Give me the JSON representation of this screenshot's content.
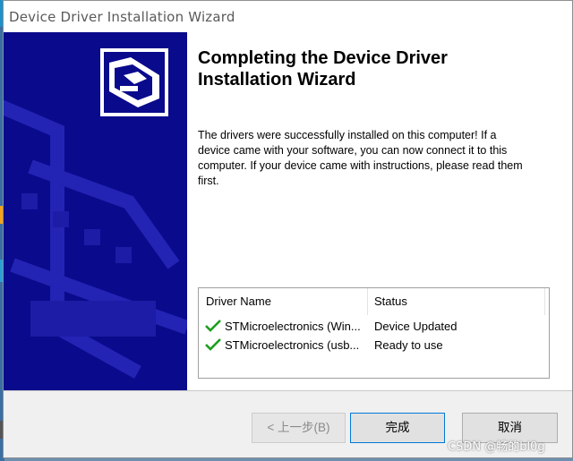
{
  "window": {
    "title": "Device Driver Installation Wizard"
  },
  "page": {
    "heading_line1": "Completing the Device Driver",
    "heading_line2": "Installation Wizard",
    "body_line1": "The drivers were successfully installed on this computer! If a",
    "body_line2": "device came with your software, you can now connect it to this",
    "body_line3": "computer. If your device came with instructions, please read them",
    "body_line4": "first."
  },
  "drivers": {
    "columns": [
      "Driver Name",
      "Status"
    ],
    "rows": [
      {
        "name": "STMicroelectronics (Win...",
        "status": "Device Updated",
        "icon": "checkmark-icon"
      },
      {
        "name": "STMicroelectronics (usb...",
        "status": "Ready to use",
        "icon": "checkmark-icon"
      }
    ]
  },
  "buttons": {
    "back": "< 上一步(B)",
    "finish": "完成",
    "cancel": "取消"
  },
  "watermark": "CSDN @畅的bl0g",
  "colors": {
    "banner": "#0a0a8c",
    "check": "#1e9e1e",
    "accent": "#0078d7"
  }
}
